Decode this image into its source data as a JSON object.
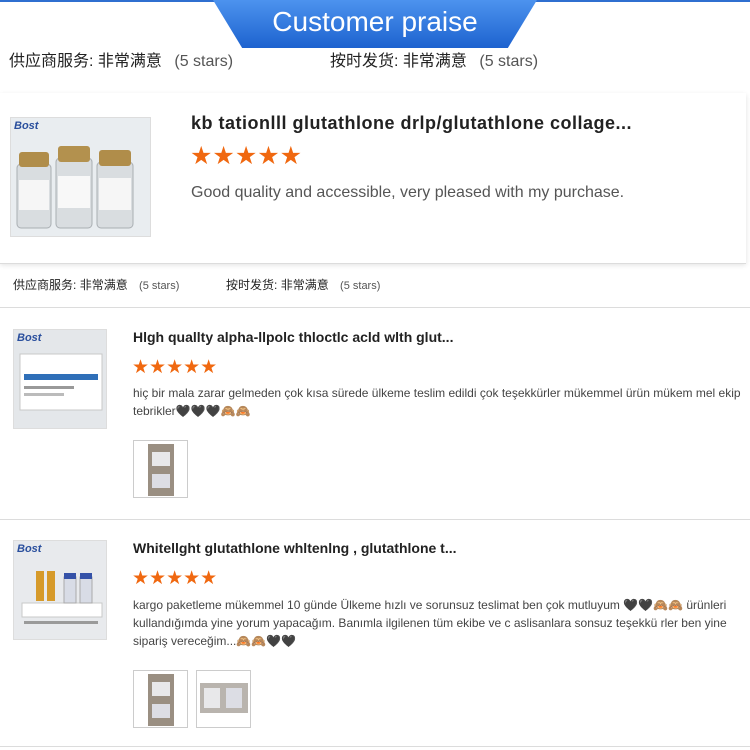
{
  "banner": {
    "title": "Customer praise"
  },
  "ratings": {
    "supplier_label": "供应商服务:",
    "supplier_value": "非常满意",
    "supplier_note": "(5 stars)",
    "delivery_label": "按时发货:",
    "delivery_value": "非常满意",
    "delivery_note": "(5 stars)"
  },
  "featured": {
    "brand": "Bost",
    "title": "kb tationlll glutathlone drlp/glutathlone collage...",
    "stars": "★★★★★",
    "rating": 5,
    "comment": "Good quality and accessible, very pleased with my purchase."
  },
  "reviews": [
    {
      "brand": "Bost",
      "title": "Hlgh quallty alpha-llpolc thloctlc acld wlth glut...",
      "stars": "★★★★★",
      "rating": 5,
      "comment": "hiç bir mala zarar gelmeden çok kısa sürede ülkeme teslim edildi çok teşekkürler mükemmel ürün mükem mel ekip tebrikler🖤🖤🖤🙈🙈"
    },
    {
      "brand": "Bost",
      "title": "Whitellght glutathlone whltenlng , glutathlone t...",
      "stars": "★★★★★",
      "rating": 5,
      "comment": "kargo paketleme mükemmel 10 günde Ülkeme hızlı  ve sorunsuz teslimat ben çok mutluyum 🖤🖤🙈🙈 ürünleri kullandığımda yine yorum yapacağım. Banımla ilgilenen tüm ekibe ve c aslisanlara sonsuz teşekkü rler ben yine sipariş vereceğim...🙈🙈🖤🖤"
    }
  ]
}
